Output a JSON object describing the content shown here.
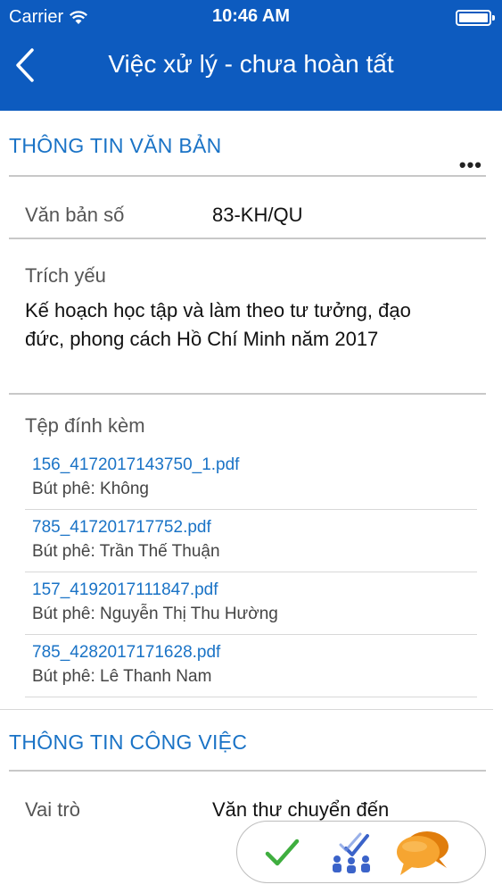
{
  "status_bar": {
    "carrier": "Carrier",
    "time": "10:46 AM"
  },
  "nav": {
    "title": "Việc xử lý - chưa hoàn tất"
  },
  "document_section": {
    "title": "THÔNG TIN VĂN BẢN",
    "doc_number_label": "Văn bản số",
    "doc_number_value": "83-KH/QU",
    "summary_label": "Trích yếu",
    "summary_line1": "Kế hoạch học tập và làm theo tư tưởng, đạo",
    "summary_line2": "đức, phong cách Hồ Chí Minh năm 2017",
    "attachments_label": "Tệp đính kèm",
    "attachments": [
      {
        "file": "156_4172017143750_1.pdf",
        "note": "Bút phê: Không"
      },
      {
        "file": "785_417201717752.pdf",
        "note": "Bút phê: Trần Thế Thuận"
      },
      {
        "file": "157_4192017111847.pdf",
        "note": "Bút phê: Nguyễn Thị Thu Hường"
      },
      {
        "file": "785_4282017171628.pdf",
        "note": "Bút phê: Lê Thanh Nam"
      }
    ]
  },
  "work_section": {
    "title": "THÔNG TIN CÔNG VIỆC",
    "role_label": "Vai trò",
    "role_value": "Văn thư chuyển đến"
  },
  "colors": {
    "nav_bg": "#0d5bbf",
    "accent": "#1a73c6",
    "check": "#3fae3f",
    "chat": "#f39a1e"
  },
  "icons": [
    "back-chevron-icon",
    "wifi-icon",
    "battery-icon",
    "more-icon",
    "checkmark-icon",
    "assign-people-icon",
    "chat-bubbles-icon"
  ]
}
